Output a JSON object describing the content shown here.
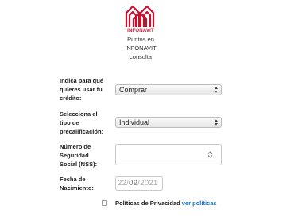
{
  "header": {
    "logo_text": "INFONAVIT",
    "subtitle_lines": [
      "Puntos en",
      "INFONAVIT",
      "consulta"
    ]
  },
  "form": {
    "credit_use": {
      "label_lines": [
        "Indica para qué",
        "quieres usar tu",
        "crédito:"
      ],
      "value": "Comprar"
    },
    "precalification": {
      "label_lines": [
        "Selecciona el",
        "tipo de",
        "precalificación:"
      ],
      "value": "Individual"
    },
    "nss": {
      "label_lines": [
        "Número de",
        "Seguridad",
        "Social (NSS):"
      ],
      "value": ""
    },
    "birth_date": {
      "label_lines": [
        "Fecha de",
        "Nacimiento:"
      ],
      "day": "22",
      "month": "09",
      "year": "2021"
    },
    "privacy": {
      "label": "Políticas de Privacidad",
      "link": "ver políticas"
    }
  },
  "colors": {
    "brand_red": "#c8102e",
    "link_blue": "#1a73c4"
  },
  "icons": [
    "infonavit-logo",
    "select-arrows-icon",
    "spinner-icon",
    "checkbox"
  ]
}
